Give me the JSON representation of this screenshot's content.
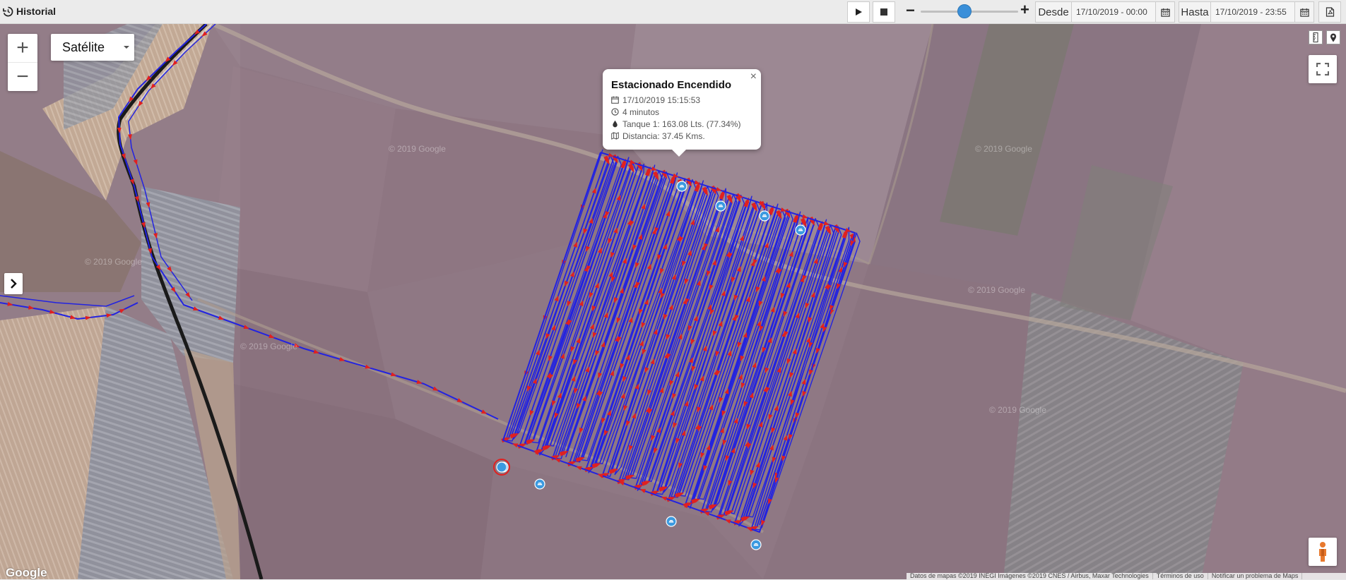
{
  "header": {
    "title": "Historial",
    "icon": "history-icon",
    "play_icon": "play-icon",
    "stop_icon": "stop-icon",
    "speed_decrease": "−",
    "speed_increase": "+",
    "playback_speed_fraction": 0.45,
    "from_label": "Desde",
    "from_value": "17/10/2019 - 00:00",
    "to_label": "Hasta",
    "to_value": "17/10/2019 - 23:55",
    "calendar_icon": "calendar-icon",
    "pdf_icon": "pdf-icon"
  },
  "map": {
    "zoom_in": "+",
    "zoom_out": "−",
    "map_type": "Satélite",
    "route_color": "#2323e0",
    "arrow_color": "#e02020",
    "marker_color": "#3b9ae0",
    "watermark": "© 2019 Google",
    "google_logo": "Google",
    "attribution": [
      "Datos de mapas ©2019 INEGI Imágenes ©2019 CNES / Airbus, Maxar Technologies",
      "Términos de uso",
      "Notificar un problema de Maps"
    ]
  },
  "popup": {
    "title": "Estacionado Encendido",
    "datetime": "17/10/2019 15:15:53",
    "duration": "4 minutos",
    "tank": "Tanque 1: 163.08 Lts. (77.34%)",
    "distance": "Distancia: 37.45 Kms.",
    "close": "×"
  }
}
